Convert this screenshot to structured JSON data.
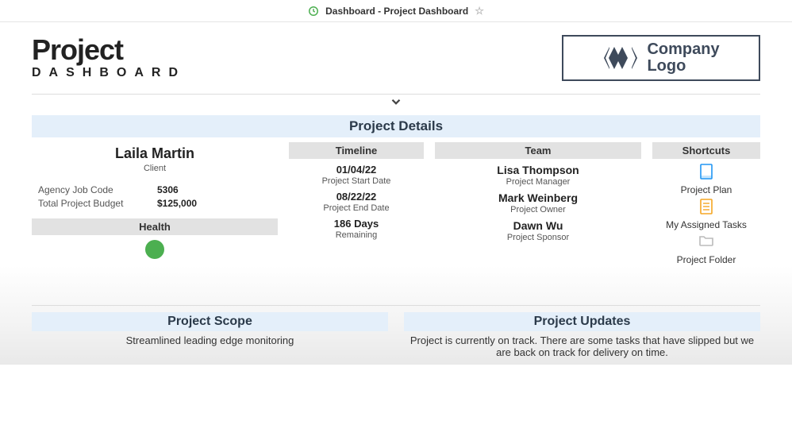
{
  "topbar": {
    "title": "Dashboard - Project Dashboard"
  },
  "header": {
    "title_line1": "Project",
    "title_line2": "DASHBOARD",
    "logo_line1": "Company",
    "logo_line2": "Logo"
  },
  "details_banner": "Project Details",
  "client": {
    "name": "Laila Martin",
    "role": "Client",
    "agency_job_code_label": "Agency Job Code",
    "agency_job_code": "5306",
    "budget_label": "Total Project Budget",
    "budget": "$125,000",
    "health_label": "Health",
    "health_color": "#4caf50"
  },
  "timeline": {
    "heading": "Timeline",
    "start_date": "01/04/22",
    "start_label": "Project Start Date",
    "end_date": "08/22/22",
    "end_label": "Project End Date",
    "remaining_value": "186 Days",
    "remaining_label": "Remaining"
  },
  "team": {
    "heading": "Team",
    "members": [
      {
        "name": "Lisa Thompson",
        "role": "Project Manager"
      },
      {
        "name": "Mark Weinberg",
        "role": "Project Owner"
      },
      {
        "name": "Dawn Wu",
        "role": "Project Sponsor"
      }
    ]
  },
  "shortcuts": {
    "heading": "Shortcuts",
    "items": [
      {
        "label": "Project Plan"
      },
      {
        "label": "My Assigned Tasks"
      },
      {
        "label": "Project Folder"
      }
    ]
  },
  "scope": {
    "heading": "Project Scope",
    "text": "Streamlined leading edge monitoring"
  },
  "updates": {
    "heading": "Project Updates",
    "text": "Project is currently on track. There are some tasks that have slipped but we are back on track for delivery on time."
  }
}
